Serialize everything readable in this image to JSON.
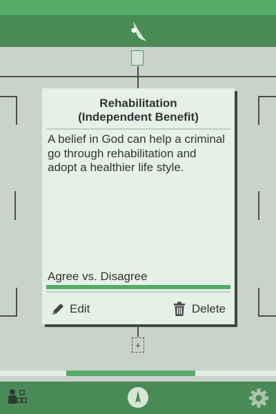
{
  "card": {
    "title_line1": "Rehabilitation",
    "title_line2": "(Independent Benefit)",
    "body": "A belief in God can help a criminal go through rehabilitation and adopt a healthier life style.",
    "stance": "Agree vs. Disagree",
    "edit_label": "Edit",
    "delete_label": "Delete"
  },
  "add_child_symbol": "+",
  "colors": {
    "accent": "#56ab66",
    "bar": "#4a8a56",
    "card_background": "#e5f1e8",
    "page_background": "#c9d3cb"
  },
  "icons": {
    "logo": "logo-icon",
    "edit": "pencil-icon",
    "delete": "trash-icon",
    "tree": "tree-view-icon",
    "navigate": "compass-icon",
    "settings": "gear-icon"
  }
}
